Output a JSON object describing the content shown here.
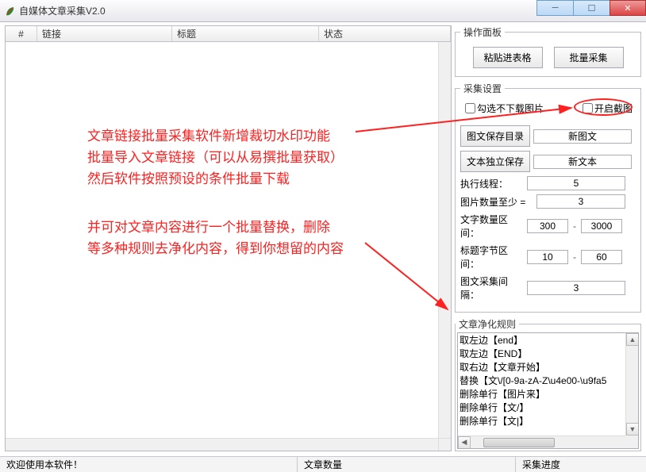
{
  "window": {
    "title": "自媒体文章采集V2.0"
  },
  "annotation": {
    "l1": "文章链接批量采集软件新增裁切水印功能",
    "l2": "批量导入文章链接（可以从易撰批量获取）",
    "l3": "然后软件按照预设的条件批量下载",
    "l4": "并可对文章内容进行一个批量替换，删除",
    "l5": "等多种规则去净化内容，得到你想留的内容"
  },
  "table": {
    "col_idx": "#",
    "col_link": "链接",
    "col_title": "标题",
    "col_status": "状态"
  },
  "panel_ops": {
    "legend": "操作面板",
    "paste": "粘贴进表格",
    "batch": "批量采集"
  },
  "settings": {
    "legend": "采集设置",
    "chk_no_dl_img": "勾选不下载图片",
    "chk_crop": "开启截图",
    "btn_img_dir": "图文保存目录",
    "img_dir_value": "新图文",
    "btn_txt_save": "文本独立保存",
    "txt_save_value": "新文本",
    "lbl_threads": "执行线程：",
    "val_threads": "5",
    "lbl_img_min": "图片数量至少 =",
    "val_img_min": "3",
    "lbl_word_range": "文字数量区间：",
    "val_word_lo": "300",
    "val_word_hi": "3000",
    "lbl_title_range": "标题字节区间：",
    "val_title_lo": "10",
    "val_title_hi": "60",
    "lbl_interval": "图文采集间隔：",
    "val_interval": "3"
  },
  "rules": {
    "legend": "文章净化规则",
    "items": [
      "取左边【end】",
      "取左边【END】",
      "取右边【文章开始】",
      "替换【文\\/[0-9a-zA-Z\\u4e00-\\u9fa5",
      "删除单行【图片来】",
      "删除单行【文/】",
      "删除单行【文|】"
    ]
  },
  "status": {
    "welcome": "欢迎使用本软件！",
    "count_label": "文章数量",
    "progress_label": "采集进度"
  }
}
